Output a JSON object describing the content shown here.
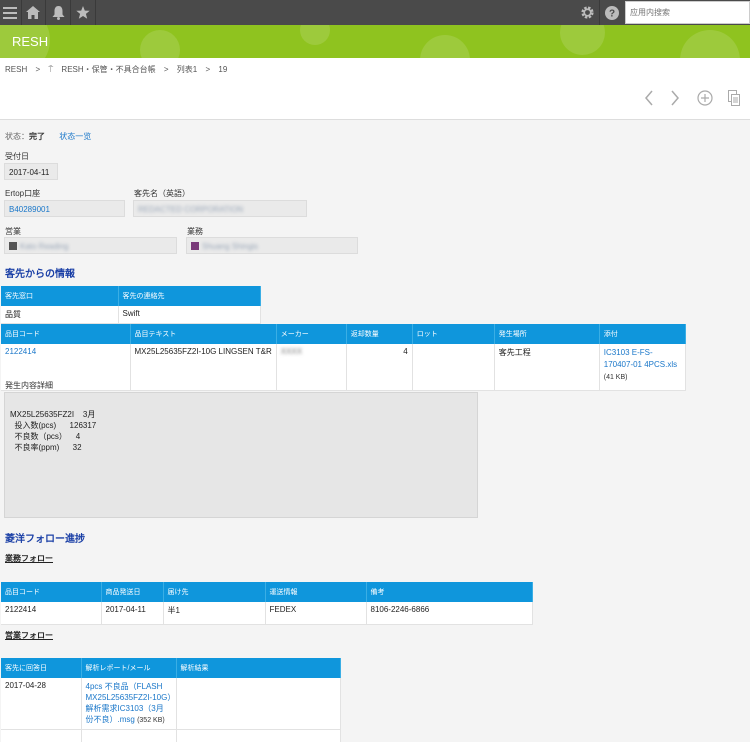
{
  "topbar": {
    "menu_icon": "menu-icon",
    "home_icon": "home-icon",
    "bell_icon": "bell-icon",
    "star_icon": "star-icon",
    "gear_icon": "gear-icon",
    "help_icon": "help-icon",
    "search_placeholder": "应用内搜索"
  },
  "banner": {
    "title": "RESH",
    "color": "#8fc31f"
  },
  "breadcrumb": [
    "RESH",
    ">",
    "RESH・保管・不具合台帳",
    ">",
    "列表1",
    ">",
    "19"
  ],
  "status": {
    "label": "状态：",
    "value": "完了",
    "list_link": "状态一览"
  },
  "fields": {
    "reception_date_label": "受付日",
    "reception_date": "2017-04-11",
    "ertop_label": "Ertop口座",
    "ertop_value": "B40289001",
    "customer_en_label": "客先名（英語）",
    "customer_en_value": "REDACTED CORPORATION",
    "sales_label": "営業",
    "sales_value": "Kato Reading",
    "business_label": "業務",
    "business_value": "Shuang Shingis"
  },
  "section_customer": {
    "title": "客先からの情報",
    "table": {
      "headers": [
        "客先窓口",
        "客先の連絡先"
      ],
      "rows": [
        [
          "品質",
          "Swift"
        ]
      ]
    }
  },
  "product_table": {
    "headers": [
      "品目コード",
      "品目テキスト",
      "メーカー",
      "返却数量",
      "ロット",
      "発生場所",
      "添付"
    ],
    "row": {
      "code": "2122414",
      "text": "MX25L25635FZ2I-10G LINGSEN T&R",
      "maker": "XXXX",
      "qty": "4",
      "lot": "",
      "place": "客先工程",
      "attach_link": "IC3103 E-FS-170407-01 4PCS.xls",
      "attach_size": "(41 KB)"
    }
  },
  "detail": {
    "label": "発生内容詳細",
    "lines": [
      "MX25L25635FZ2I    3月",
      "  投入数(pcs)      126317",
      "  不良数（pcs）    4",
      "  不良率(ppm)      32"
    ]
  },
  "section_follow": {
    "title": "菱洋フォロー進捗",
    "business_follow": "業務フォロー",
    "business_table": {
      "headers": [
        "品目コード",
        "商品発送日",
        "届け先",
        "運送情報",
        "備考"
      ],
      "rows": [
        [
          "2122414",
          "2017-04-11",
          "半1",
          "FEDEX",
          "8106-2246-6866"
        ]
      ]
    },
    "sales_follow": "営業フォロー",
    "sales_table": {
      "headers": [
        "客先に回答日",
        "解析レポート/メール",
        "解析結果"
      ],
      "row": {
        "date": "2017-04-28",
        "link": "4pcs 不良品（FLASH MX25L25635FZ2I-10G）解析需求IC3103（3月份不良）.msg",
        "size": "(352 KB)",
        "result": ""
      }
    }
  }
}
